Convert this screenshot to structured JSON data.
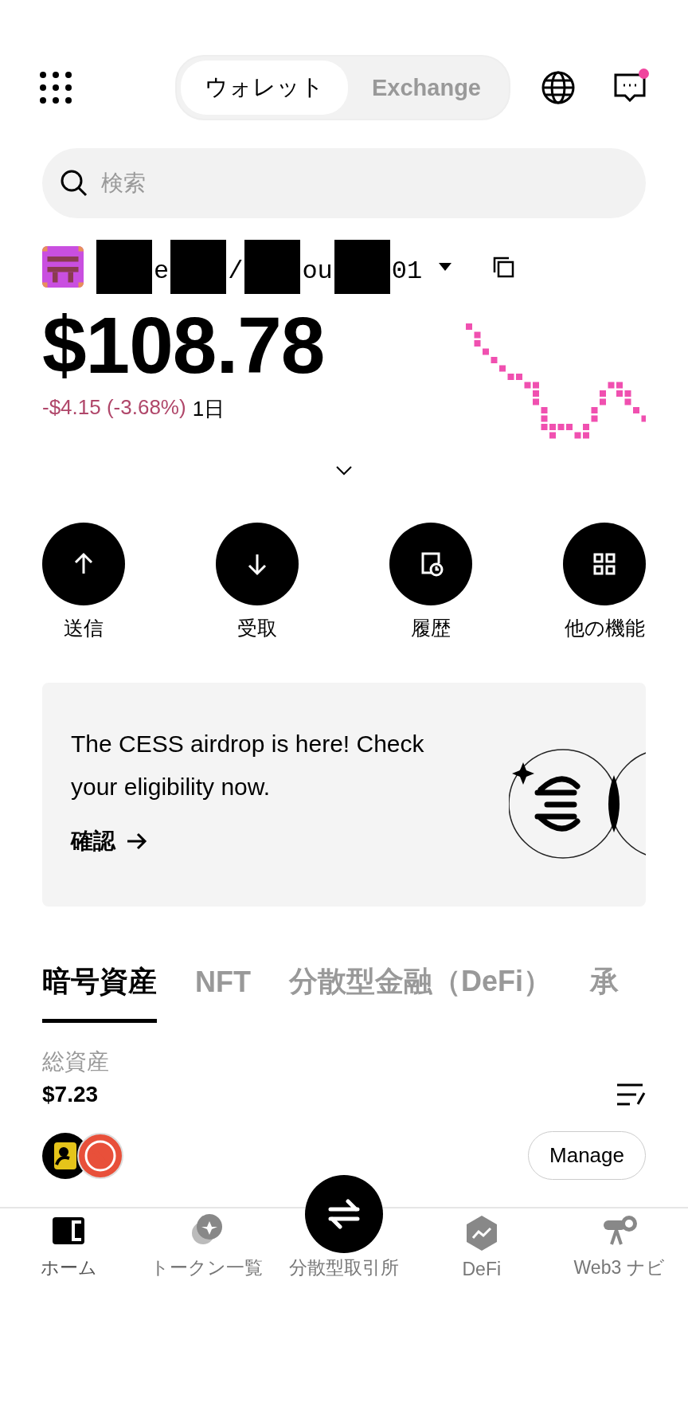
{
  "top_bar": {
    "segments": [
      {
        "label": "ウォレット",
        "selected": true
      },
      {
        "label": "Exchange",
        "selected": false
      }
    ],
    "messages": {
      "unread": true
    }
  },
  "search": {
    "placeholder": "検索"
  },
  "account": {
    "name_fragments": [
      "e",
      "/",
      "ou",
      "01"
    ]
  },
  "balance": {
    "amount": "$108.78",
    "change": "-$4.15 (-3.68%)",
    "period": "1日"
  },
  "actions": [
    {
      "kind": "send",
      "label": "送信"
    },
    {
      "kind": "receive",
      "label": "受取"
    },
    {
      "kind": "history",
      "label": "履歴"
    },
    {
      "kind": "more",
      "label": "他の機能"
    }
  ],
  "banner": {
    "text": "The CESS airdrop is here! Check your eligibility now.",
    "link": "確認"
  },
  "tabs": [
    {
      "label": "暗号資産",
      "selected": true
    },
    {
      "label": "NFT",
      "selected": false
    },
    {
      "label": "分散型金融（DeFi）",
      "selected": false
    },
    {
      "label": "承",
      "selected": false
    }
  ],
  "assets": {
    "label": "総資産",
    "total": "$7.23",
    "manage": "Manage"
  },
  "nav": [
    {
      "kind": "home",
      "label": "ホーム",
      "selected": true
    },
    {
      "kind": "tokens",
      "label": "トークン一覧",
      "selected": false
    },
    {
      "kind": "dex",
      "label": "分散型取引所",
      "selected": false
    },
    {
      "kind": "defi",
      "label": "DeFi",
      "selected": false
    },
    {
      "kind": "web3",
      "label": "Web3 ナビ",
      "selected": false
    }
  ]
}
